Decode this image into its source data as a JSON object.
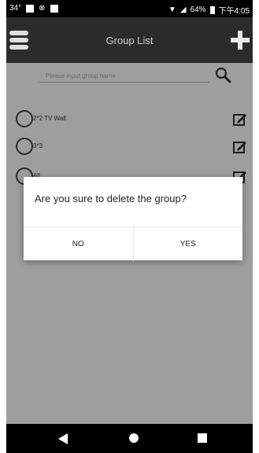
{
  "status_bar": {
    "temp": "34°",
    "battery_pct": "64%",
    "time": "下午4:05"
  },
  "app_bar": {
    "title": "Group List"
  },
  "search": {
    "placeholder": "Please input group name"
  },
  "groups": [
    {
      "label": "2*2 TV Wall"
    },
    {
      "label": "3*3"
    },
    {
      "label": "All"
    }
  ],
  "dialog": {
    "message": "Are you sure to delete the group?",
    "no_label": "NO",
    "yes_label": "YES"
  }
}
